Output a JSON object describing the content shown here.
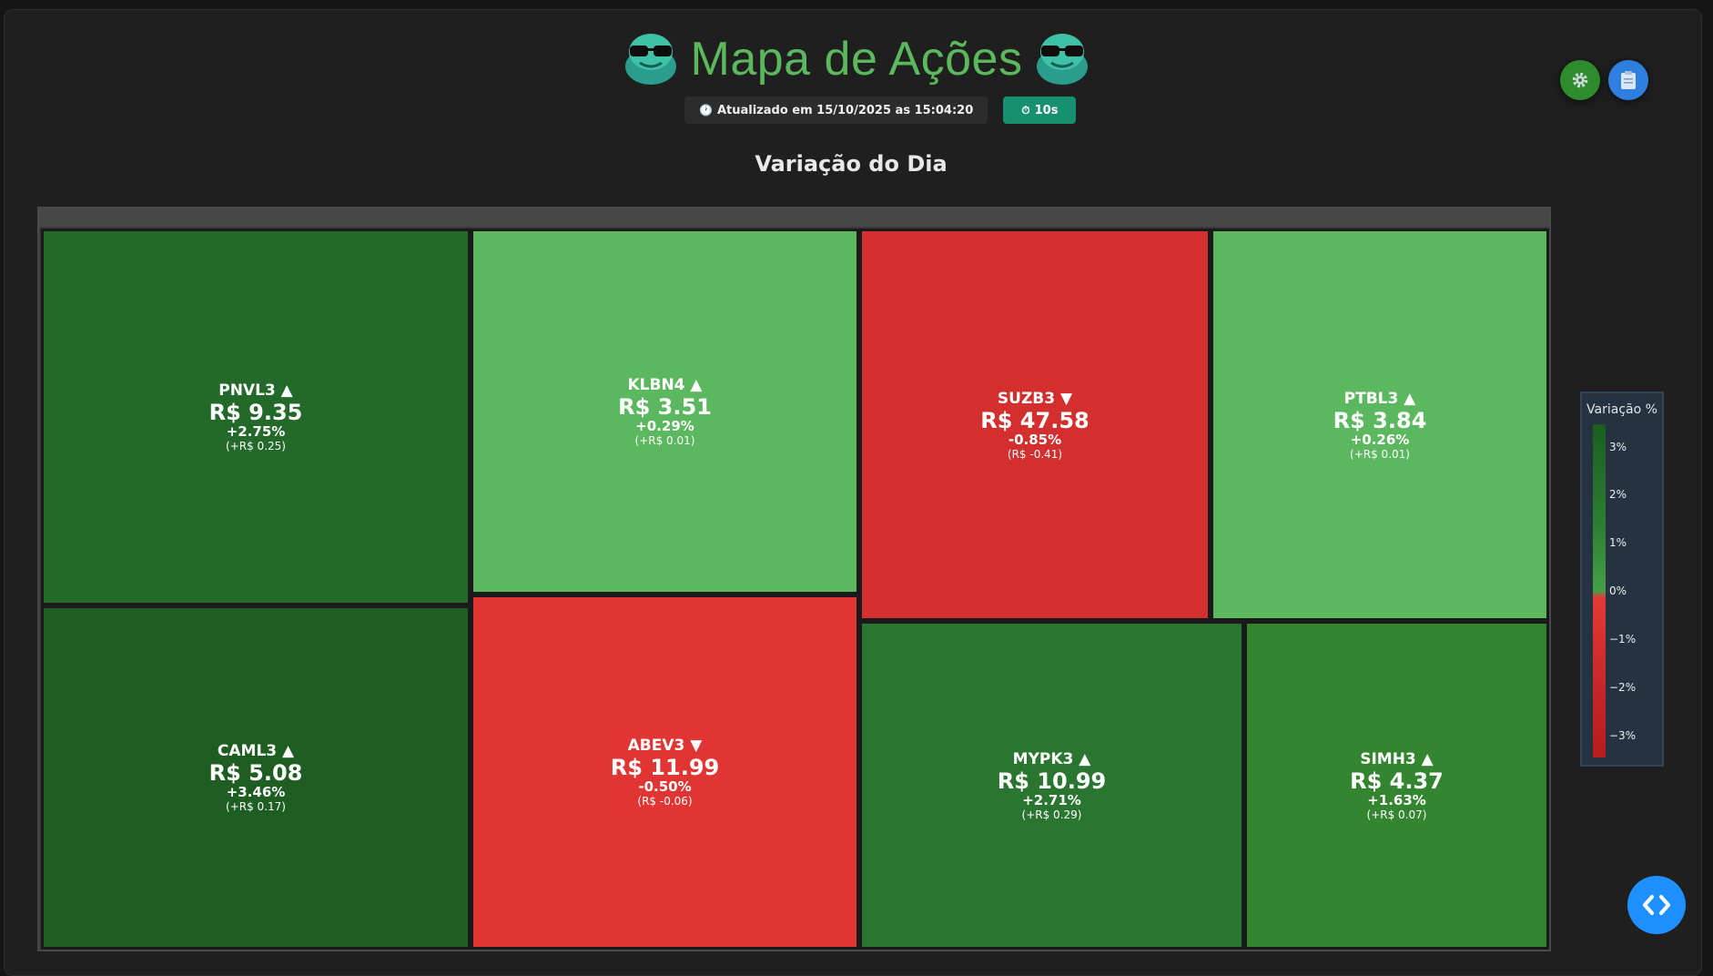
{
  "header": {
    "title": "Mapa de Ações",
    "updated_text": "Atualizado em 15/10/2025 as 15:04:20",
    "timer_text": "10s",
    "timer_icon": "stopwatch-icon",
    "updated_icon": "clock-icon"
  },
  "buttons": {
    "settings_icon": "gear-icon",
    "notes_icon": "clipboard-icon",
    "code_icon": "code-brackets-icon"
  },
  "section": {
    "title": "Variação do Dia"
  },
  "colors": {
    "strong_up": "#1f5f22",
    "up": "#2a7d30",
    "mid_up": "#33902e",
    "light_up": "#5cb85c",
    "down": "#e03532",
    "down2": "#d32f2f"
  },
  "tiles": [
    {
      "ticker": "PNVL3 ▲",
      "price": "R$ 9.35",
      "pct": "+2.75%",
      "abs": "(+R$ 0.25)"
    },
    {
      "ticker": "KLBN4 ▲",
      "price": "R$ 3.51",
      "pct": "+0.29%",
      "abs": "(+R$ 0.01)"
    },
    {
      "ticker": "SUZB3 ▼",
      "price": "R$ 47.58",
      "pct": "-0.85%",
      "abs": "(R$ -0.41)"
    },
    {
      "ticker": "PTBL3 ▲",
      "price": "R$ 3.84",
      "pct": "+0.26%",
      "abs": "(+R$ 0.01)"
    },
    {
      "ticker": "CAML3 ▲",
      "price": "R$ 5.08",
      "pct": "+3.46%",
      "abs": "(+R$ 0.17)"
    },
    {
      "ticker": "ABEV3 ▼",
      "price": "R$ 11.99",
      "pct": "-0.50%",
      "abs": "(R$ -0.06)"
    },
    {
      "ticker": "MYPK3 ▲",
      "price": "R$ 10.99",
      "pct": "+2.71%",
      "abs": "(+R$ 0.29)"
    },
    {
      "ticker": "SIMH3 ▲",
      "price": "R$ 4.37",
      "pct": "+1.63%",
      "abs": "(+R$ 0.07)"
    }
  ],
  "legend": {
    "title": "Variação %",
    "ticks": [
      "3%",
      "2%",
      "1%",
      "0%",
      "−1%",
      "−2%",
      "−3%"
    ]
  }
}
